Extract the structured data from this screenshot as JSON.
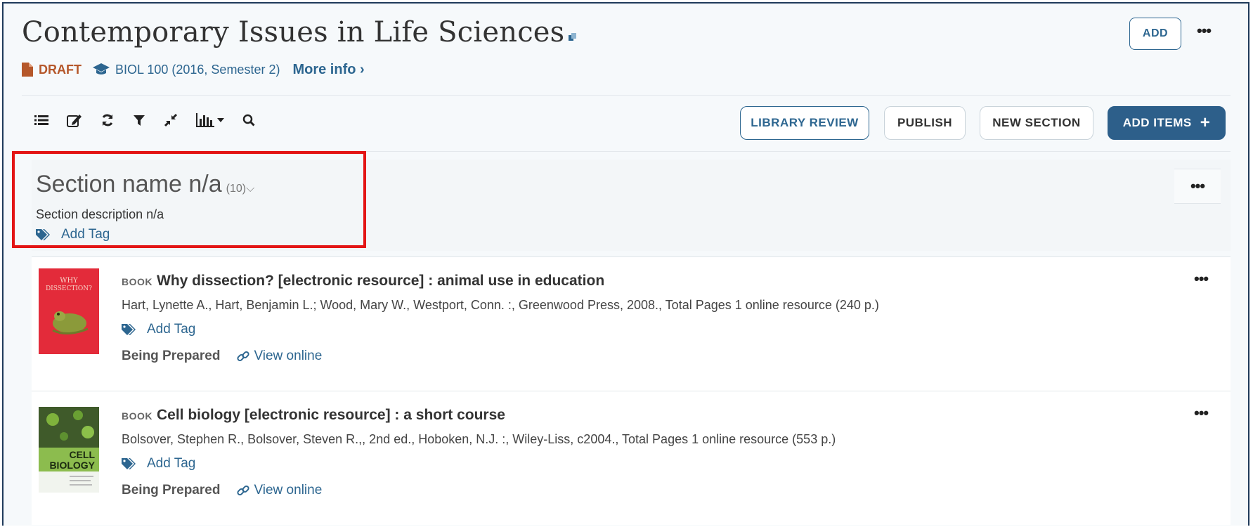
{
  "header": {
    "title": "Contemporary Issues in Life Sciences",
    "status": "DRAFT",
    "course": "BIOL 100 (2016, Semester 2)",
    "more_info": "More info",
    "add_label": "ADD",
    "more_dots": "•••"
  },
  "toolbar": {
    "library_review": "LIBRARY REVIEW",
    "publish": "PUBLISH",
    "new_section": "NEW SECTION",
    "add_items": "ADD ITEMS",
    "add_items_icon": "+"
  },
  "section": {
    "name": "Section name n/a",
    "count": "(10)",
    "chevron": "⌵",
    "description": "Section description n/a",
    "add_tag": "Add Tag",
    "more_dots": "•••"
  },
  "items": [
    {
      "type": "BOOK",
      "title": "Why dissection? [electronic resource] : animal use in education",
      "meta": "Hart, Lynette A., Hart, Benjamin L.; Wood, Mary W., Westport, Conn. :, Greenwood Press, 2008., Total Pages 1 online resource (240 p.)",
      "add_tag": "Add Tag",
      "status": "Being Prepared",
      "view_online": "View online",
      "more_dots": "•••",
      "cover_lines": [
        "WHY",
        "DISSECTION?"
      ]
    },
    {
      "type": "BOOK",
      "title": "Cell biology [electronic resource] : a short course",
      "meta": "Bolsover, Stephen R., Bolsover, Steven R.,, 2nd ed., Hoboken, N.J. :, Wiley-Liss, c2004., Total Pages 1 online resource (553 p.)",
      "add_tag": "Add Tag",
      "status": "Being Prepared",
      "view_online": "View online",
      "more_dots": "•••",
      "cover_lines": [
        "CELL",
        "BIOLOGY"
      ]
    }
  ],
  "colors": {
    "accent": "#2d6690",
    "draft": "#b5572a",
    "highlight": "#e31515"
  }
}
